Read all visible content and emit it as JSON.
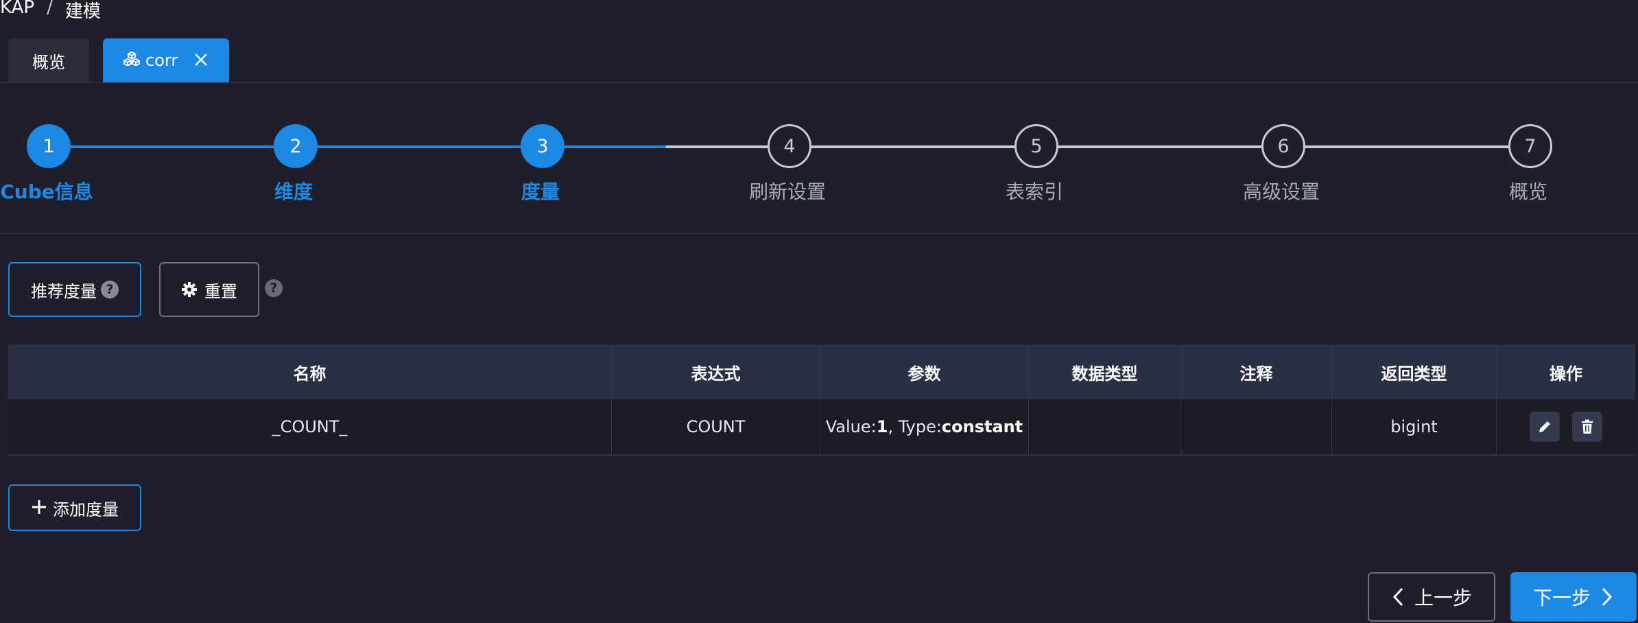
{
  "breadcrumb": {
    "root": "KAP",
    "separator": "/",
    "current": "建模"
  },
  "tabs": {
    "overview": "概览",
    "active": "corr"
  },
  "steps": [
    {
      "num": "1",
      "label": "Cube信息",
      "state": "done"
    },
    {
      "num": "2",
      "label": "维度",
      "state": "done"
    },
    {
      "num": "3",
      "label": "度量",
      "state": "done"
    },
    {
      "num": "4",
      "label": "刷新设置",
      "state": "todo"
    },
    {
      "num": "5",
      "label": "表索引",
      "state": "todo"
    },
    {
      "num": "6",
      "label": "高级设置",
      "state": "todo"
    },
    {
      "num": "7",
      "label": "概览",
      "state": "todo"
    }
  ],
  "toolbar": {
    "recommend_label": "推荐度量",
    "reset_label": "重置"
  },
  "table": {
    "columns": [
      "名称",
      "表达式",
      "参数",
      "数据类型",
      "注释",
      "返回类型",
      "操作"
    ],
    "rows": [
      {
        "name": "_COUNT_",
        "expression": "COUNT",
        "param_value_label": "Value:",
        "param_value": "1",
        "param_type_label": ", Type:",
        "param_type": "constant",
        "data_type": "",
        "comment": "",
        "return_type": "bigint"
      }
    ]
  },
  "add_measure_label": "添加度量",
  "footer": {
    "prev_label": "上一步",
    "next_label": "下一步"
  },
  "colors": {
    "accent": "#1e88e5",
    "background": "#1f1f2b",
    "header_bg": "#2a2f44"
  },
  "icons": {
    "tab": "cubes-icon",
    "close": "close-icon",
    "reset": "gear-icon",
    "help": "question-icon",
    "edit": "pencil-icon",
    "delete": "trash-icon",
    "add": "plus-icon",
    "prev": "chevron-left-icon",
    "next": "chevron-right-icon"
  }
}
